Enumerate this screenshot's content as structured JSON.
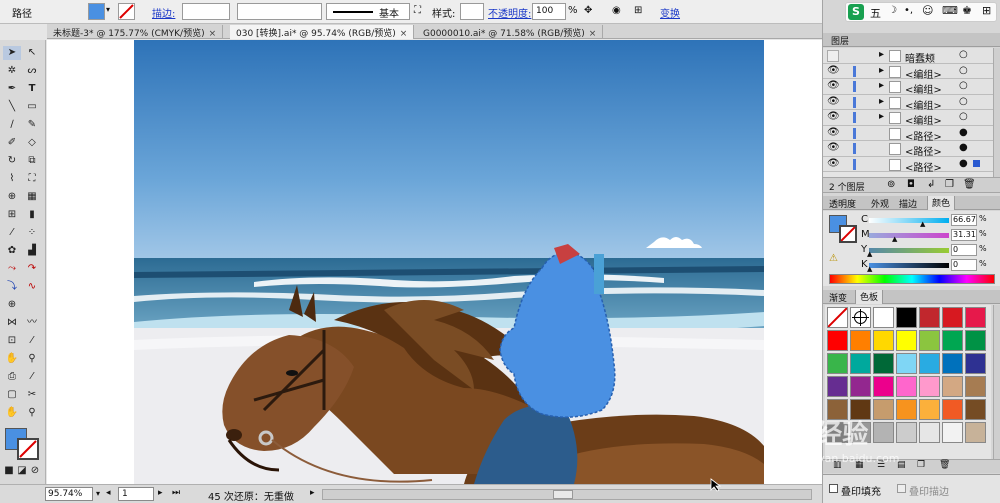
{
  "control_bar": {
    "object_type": "路径",
    "stroke_label": "描边:",
    "stroke_style": "基本",
    "style_label": "样式:",
    "opacity_label": "不透明度:",
    "opacity_value": "100",
    "percent": "%",
    "transform_label": "变换",
    "fill_color": "#4a90e2"
  },
  "tabs": [
    {
      "label": "未标题-3* @ 175.77% (CMYK/预览)",
      "active": false
    },
    {
      "label": "030 [转换].ai* @ 95.74% (RGB/预览)",
      "active": true
    },
    {
      "label": "G0000010.ai* @ 71.58% (RGB/预览)",
      "active": false
    }
  ],
  "status_bar": {
    "zoom": "95.74%",
    "artboard": "1",
    "undo_text": "45 次还原：无重做"
  },
  "ime_bar": {
    "logo": "S",
    "label": "五"
  },
  "layers": {
    "title": "图层",
    "rows": [
      {
        "name": "暗蠢颊",
        "visible": false
      },
      {
        "name": "<编组>",
        "visible": true
      },
      {
        "name": "<编组>",
        "visible": true
      },
      {
        "name": "<编组>",
        "visible": true
      },
      {
        "name": "<编组>",
        "visible": true
      },
      {
        "name": "<路径>",
        "visible": true
      },
      {
        "name": "<路径>",
        "visible": true
      },
      {
        "name": "<路径>",
        "visible": true
      }
    ],
    "count": "2 个图层"
  },
  "color_panel": {
    "tabs": [
      "透明度",
      "外观",
      "描边",
      "颜色"
    ],
    "channels": [
      {
        "label": "C",
        "value": "66.67"
      },
      {
        "label": "M",
        "value": "31.31"
      },
      {
        "label": "Y",
        "value": "0"
      },
      {
        "label": "K",
        "value": "0"
      }
    ],
    "percent": "%"
  },
  "swatches": {
    "tabs": [
      "渐变",
      "色板"
    ],
    "colors": [
      "#ffffff",
      "#ffffff",
      "#ffffff",
      "#000000",
      "#c1272d",
      "#d71920",
      "#e6194b",
      "#ff0000",
      "#ff7f00",
      "#ffd800",
      "#ffff00",
      "#8bc53f",
      "#00a651",
      "#009245",
      "#39b54a",
      "#00a99d",
      "#006837",
      "#7fd6f5",
      "#29abe2",
      "#0071bc",
      "#2e3192",
      "#662d91",
      "#93278f",
      "#ec008c",
      "#ff66cc",
      "#ff99cc",
      "#d3a883",
      "#a67c52",
      "#8c6239",
      "#603813",
      "#c69c6d",
      "#f7931e",
      "#fbb03b",
      "#f15a24",
      "#754c24",
      "#7f7f7f",
      "#999999",
      "#b3b3b3",
      "#cccccc",
      "#e6e6e6",
      "#f2f2f2",
      "#c7b299"
    ]
  },
  "bottom_panel": {
    "fill_overprint": "叠印填充",
    "stroke_overprint": "叠印描边"
  },
  "watermark": {
    "text": "Bai经验",
    "url": "jingyan.baidu.com"
  }
}
